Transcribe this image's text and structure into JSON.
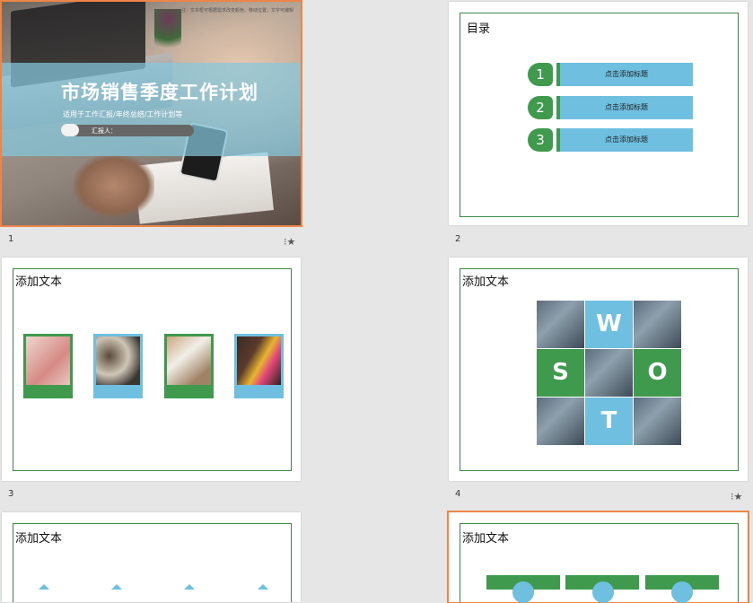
{
  "slides": [
    {
      "number": "1",
      "title": "市场销售季度工作计划",
      "subtitle": "适用于工作汇报/年终总结/工作计划等",
      "reporter": "汇报人：",
      "note": "注：文本框可根据需求改变颜色、移动位置；文字可编辑"
    },
    {
      "number": "2",
      "title": "目录",
      "items": [
        {
          "num": "1",
          "label": "点击添加标题"
        },
        {
          "num": "2",
          "label": "点击添加标题"
        },
        {
          "num": "3",
          "label": "点击添加标题"
        }
      ]
    },
    {
      "number": "3",
      "title": "添加文本"
    },
    {
      "number": "4",
      "title": "添加文本",
      "swot": [
        "W",
        "S",
        "O",
        "T"
      ]
    },
    {
      "number": "",
      "title": "添加文本"
    },
    {
      "number": "",
      "title": "添加文本"
    }
  ],
  "icons": {
    "star": "star-icon"
  },
  "colors": {
    "accent_green": "#3f9a4e",
    "accent_blue": "#6ebfe0",
    "selection": "#ee8548"
  }
}
